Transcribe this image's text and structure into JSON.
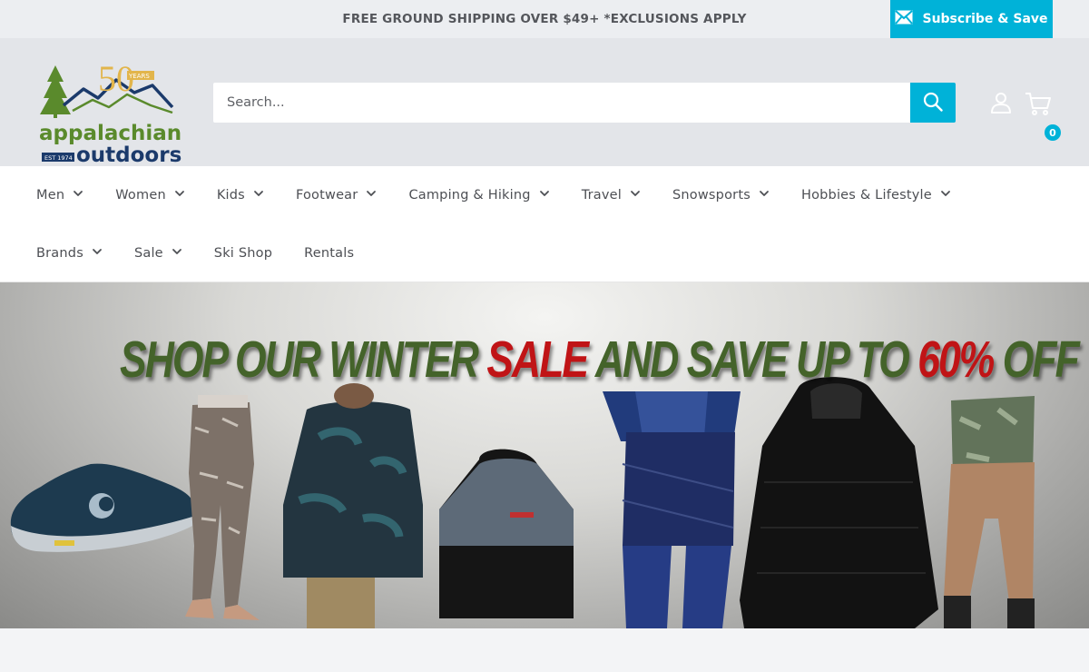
{
  "announcement": {
    "text": "FREE GROUND SHIPPING OVER $49+ *EXCLUSIONS APPLY",
    "subscribe_label": "Subscribe & Save"
  },
  "brand": {
    "logo_badge_number": "50",
    "logo_badge_word": "YEARS",
    "logo_line1": "appalachian",
    "logo_line2": "outdoors",
    "logo_est": "EST 1974"
  },
  "search": {
    "placeholder": "Search..."
  },
  "cart": {
    "count": "0"
  },
  "nav": {
    "row1": [
      {
        "label": "Men",
        "has_dropdown": true
      },
      {
        "label": "Women",
        "has_dropdown": true
      },
      {
        "label": "Kids",
        "has_dropdown": true
      },
      {
        "label": "Footwear",
        "has_dropdown": true
      },
      {
        "label": "Camping & Hiking",
        "has_dropdown": true
      },
      {
        "label": "Travel",
        "has_dropdown": true
      },
      {
        "label": "Snowsports",
        "has_dropdown": true
      },
      {
        "label": "Hobbies & Lifestyle",
        "has_dropdown": true
      }
    ],
    "row2": [
      {
        "label": "Brands",
        "has_dropdown": true
      },
      {
        "label": "Sale",
        "has_dropdown": true
      },
      {
        "label": "Ski Shop",
        "has_dropdown": false
      },
      {
        "label": "Rentals",
        "has_dropdown": false
      }
    ]
  },
  "hero": {
    "title_part1": "SHOP OUR WINTER ",
    "title_red1": "SALE",
    "title_part2": " AND SAVE UP TO ",
    "title_red2": "60%",
    "title_part3": " OFF"
  },
  "colors": {
    "accent": "#00b2d8",
    "logo_green": "#5a8a2c",
    "logo_navy": "#1b3a6b",
    "logo_gold": "#e2b54b",
    "banner_green": "#44632a",
    "banner_red": "#c01416"
  }
}
